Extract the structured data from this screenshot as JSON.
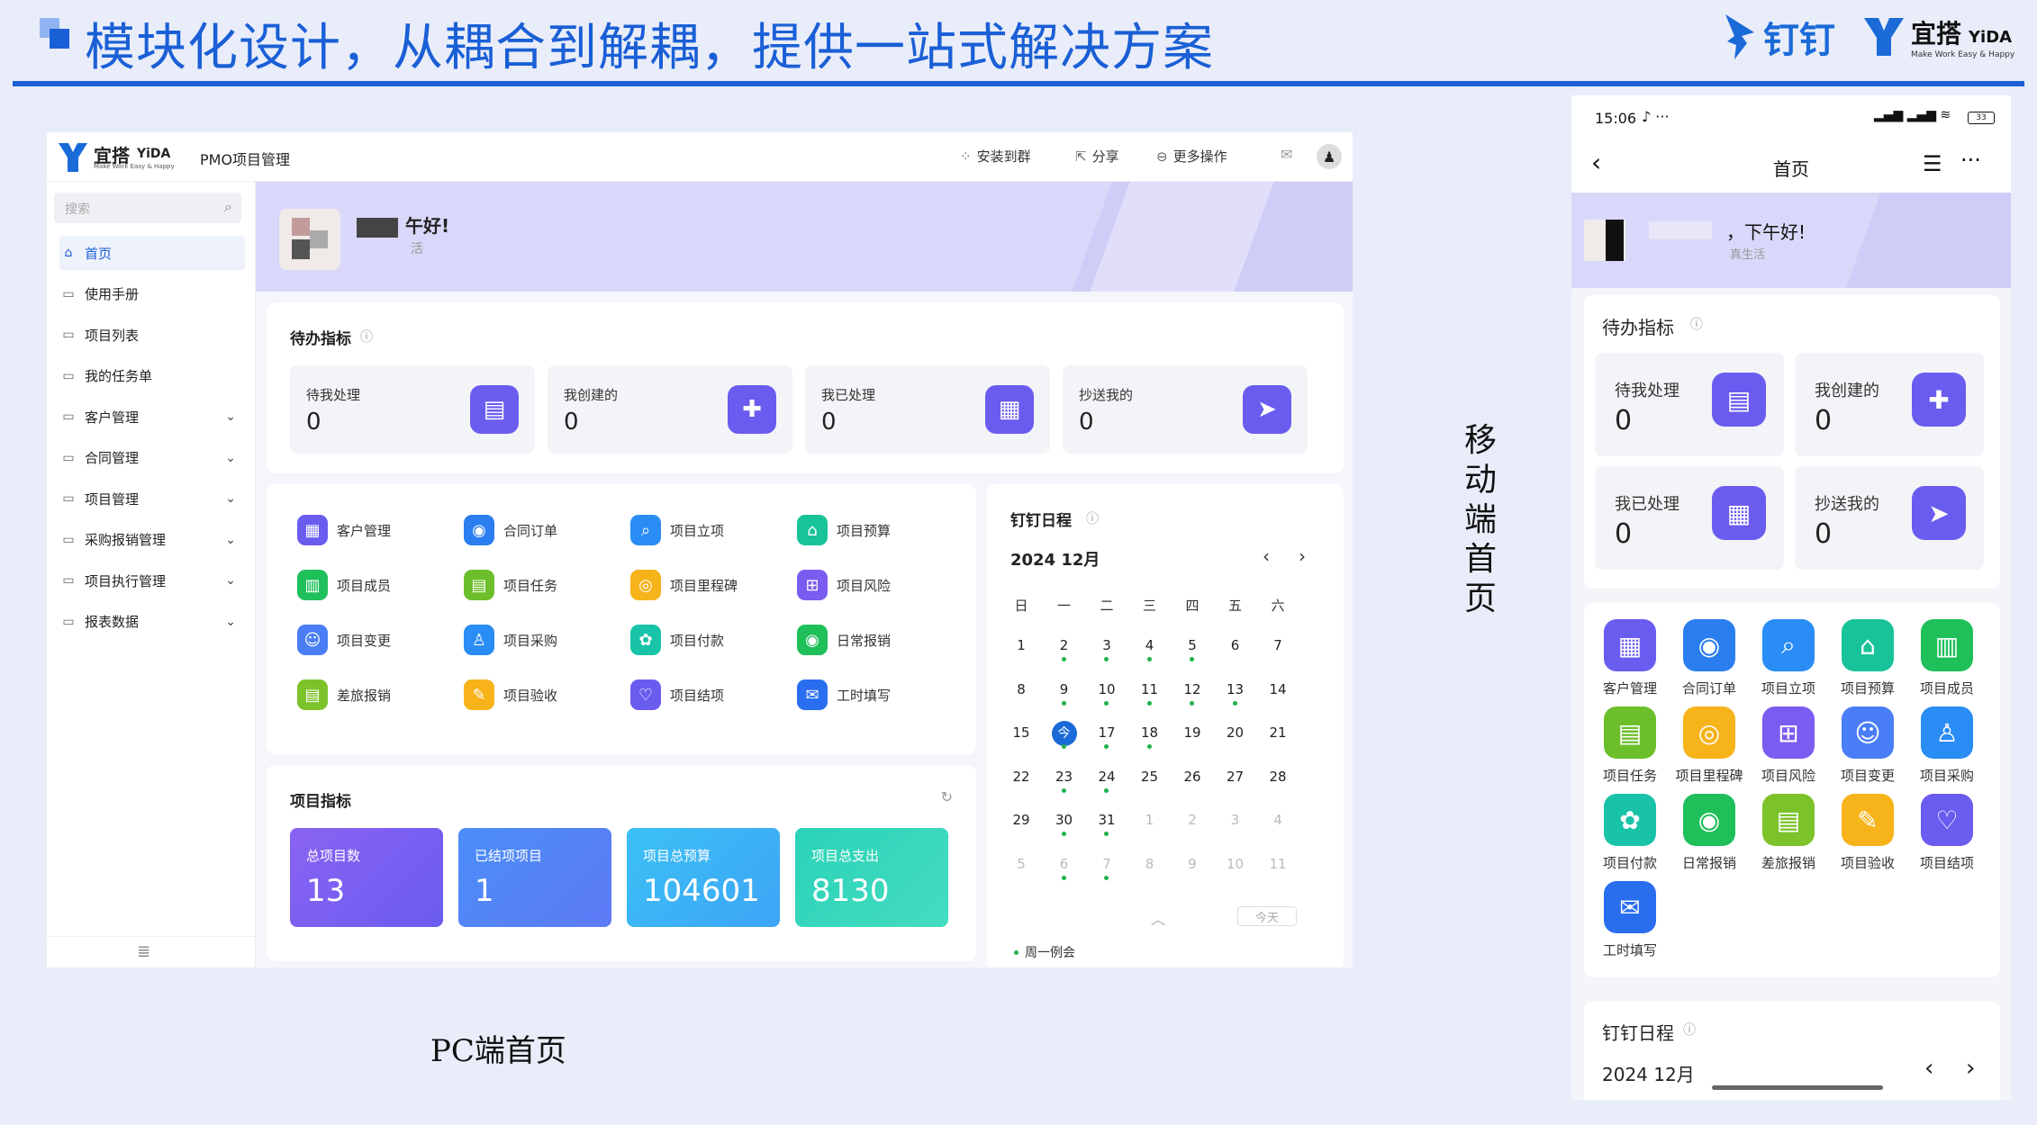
{
  "slide": {
    "title": "模块化设计，从耦合到解耦，提供一站式解决方案",
    "brand_dingtalk": "钉钉",
    "brand_yida": "宜搭",
    "brand_yida_en": "YiDA",
    "brand_yida_slogan": "Make Work Easy & Happy",
    "pc_caption": "PC端首页",
    "mobile_caption": "移动端首页"
  },
  "pc": {
    "logo_cn": "宜搭",
    "logo_en": "YiDA",
    "logo_slogan": "Make Work Easy & Happy",
    "app_name": "PMO项目管理",
    "actions": {
      "install": "安装到群",
      "share": "分享",
      "more": "更多操作"
    },
    "search_placeholder": "搜索",
    "sidebar": [
      {
        "label": "首页",
        "icon": "home-icon",
        "active": true,
        "expandable": false
      },
      {
        "label": "使用手册",
        "icon": "page-icon",
        "expandable": false
      },
      {
        "label": "项目列表",
        "icon": "page-icon",
        "expandable": false
      },
      {
        "label": "我的任务单",
        "icon": "page-icon",
        "expandable": false
      },
      {
        "label": "客户管理",
        "icon": "folder-icon",
        "expandable": true
      },
      {
        "label": "合同管理",
        "icon": "folder-icon",
        "expandable": true
      },
      {
        "label": "项目管理",
        "icon": "folder-icon",
        "expandable": true
      },
      {
        "label": "采购报销管理",
        "icon": "folder-icon",
        "expandable": true
      },
      {
        "label": "项目执行管理",
        "icon": "folder-icon",
        "expandable": true
      },
      {
        "label": "报表数据",
        "icon": "folder-icon",
        "expandable": true
      }
    ],
    "greeting": "午好!",
    "greeting_sub": "活",
    "todo": {
      "title": "待办指标",
      "tiles": [
        {
          "label": "待我处理",
          "value": "0",
          "icon": "doc-icon"
        },
        {
          "label": "我创建的",
          "value": "0",
          "icon": "plus-icon"
        },
        {
          "label": "我已处理",
          "value": "0",
          "icon": "calendar-check-icon"
        },
        {
          "label": "抄送我的",
          "value": "0",
          "icon": "send-icon"
        }
      ]
    },
    "apps": [
      {
        "label": "客户管理",
        "color": "#6b5cf0",
        "glyph": "▦"
      },
      {
        "label": "合同订单",
        "color": "#2a7ef0",
        "glyph": "◉"
      },
      {
        "label": "项目立项",
        "color": "#2a8cf5",
        "glyph": "⌕"
      },
      {
        "label": "项目预算",
        "color": "#19c39a",
        "glyph": "⌂"
      },
      {
        "label": "项目成员",
        "color": "#1fbf5a",
        "glyph": "▥"
      },
      {
        "label": "项目任务",
        "color": "#6cbf2a",
        "glyph": "▤"
      },
      {
        "label": "项目里程碑",
        "color": "#f6b31a",
        "glyph": "◎"
      },
      {
        "label": "项目风险",
        "color": "#7b5cf0",
        "glyph": "⊞"
      },
      {
        "label": "项目变更",
        "color": "#4a7ef6",
        "glyph": "☺"
      },
      {
        "label": "项目采购",
        "color": "#2a8cf5",
        "glyph": "♙"
      },
      {
        "label": "项目付款",
        "color": "#19c3a8",
        "glyph": "✿"
      },
      {
        "label": "日常报销",
        "color": "#1fbf5a",
        "glyph": "◉"
      },
      {
        "label": "差旅报销",
        "color": "#7cc22a",
        "glyph": "▤"
      },
      {
        "label": "项目验收",
        "color": "#f6b31a",
        "glyph": "✎"
      },
      {
        "label": "项目结项",
        "color": "#6b5cf0",
        "glyph": "♡"
      },
      {
        "label": "工时填写",
        "color": "#2a6ef0",
        "glyph": "✉"
      }
    ],
    "metrics": {
      "title": "项目指标",
      "items": [
        {
          "label": "总项目数",
          "value": "13",
          "from": "#8a63f3",
          "to": "#6a5cf0"
        },
        {
          "label": "已结项项目",
          "value": "1",
          "from": "#4b8ef8",
          "to": "#5d7af5"
        },
        {
          "label": "项目总预算",
          "value": "104601",
          "from": "#3cc0f5",
          "to": "#3da5f6"
        },
        {
          "label": "项目总支出",
          "value": "8130",
          "from": "#2ad3b8",
          "to": "#45dcc0"
        }
      ]
    },
    "calendar": {
      "title": "钉钉日程",
      "month": "2024 12月",
      "weekdays": [
        "日",
        "一",
        "二",
        "三",
        "四",
        "五",
        "六"
      ],
      "weeks": [
        [
          "1",
          "2",
          "3",
          "4",
          "5",
          "6",
          "7"
        ],
        [
          "8",
          "9",
          "10",
          "11",
          "12",
          "13",
          "14"
        ],
        [
          "15",
          "今",
          "17",
          "18",
          "19",
          "20",
          "21"
        ],
        [
          "22",
          "23",
          "24",
          "25",
          "26",
          "27",
          "28"
        ],
        [
          "29",
          "30",
          "31",
          "1",
          "2",
          "3",
          "4"
        ],
        [
          "5",
          "6",
          "7",
          "8",
          "9",
          "10",
          "11"
        ]
      ],
      "today_button": "今天",
      "event": "周一例会"
    }
  },
  "mobile": {
    "time": "15:06",
    "battery": "33",
    "page_title": "首页",
    "greeting": "，下午好!",
    "greeting_sub": "真生活",
    "todo": {
      "title": "待办指标",
      "tiles": [
        {
          "label": "待我处理",
          "value": "0"
        },
        {
          "label": "我创建的",
          "value": "0"
        },
        {
          "label": "我已处理",
          "value": "0"
        },
        {
          "label": "抄送我的",
          "value": "0"
        }
      ]
    },
    "apps": [
      "客户管理",
      "合同订单",
      "项目立项",
      "项目预算",
      "项目成员",
      "项目任务",
      "项目里程碑",
      "项目风险",
      "项目变更",
      "项目采购",
      "项目付款",
      "日常报销",
      "差旅报销",
      "项目验收",
      "项目结项",
      "工时填写"
    ],
    "app_colors": [
      "#6b5cf0",
      "#2a7ef0",
      "#2a8cf5",
      "#19c39a",
      "#1fbf5a",
      "#6cbf2a",
      "#f6b31a",
      "#7b5cf0",
      "#4a7ef6",
      "#2a8cf5",
      "#19c3a8",
      "#1fbf5a",
      "#7cc22a",
      "#f6b31a",
      "#6b5cf0",
      "#2a6ef0"
    ],
    "calendar": {
      "title": "钉钉日程",
      "month": "2024 12月"
    }
  }
}
